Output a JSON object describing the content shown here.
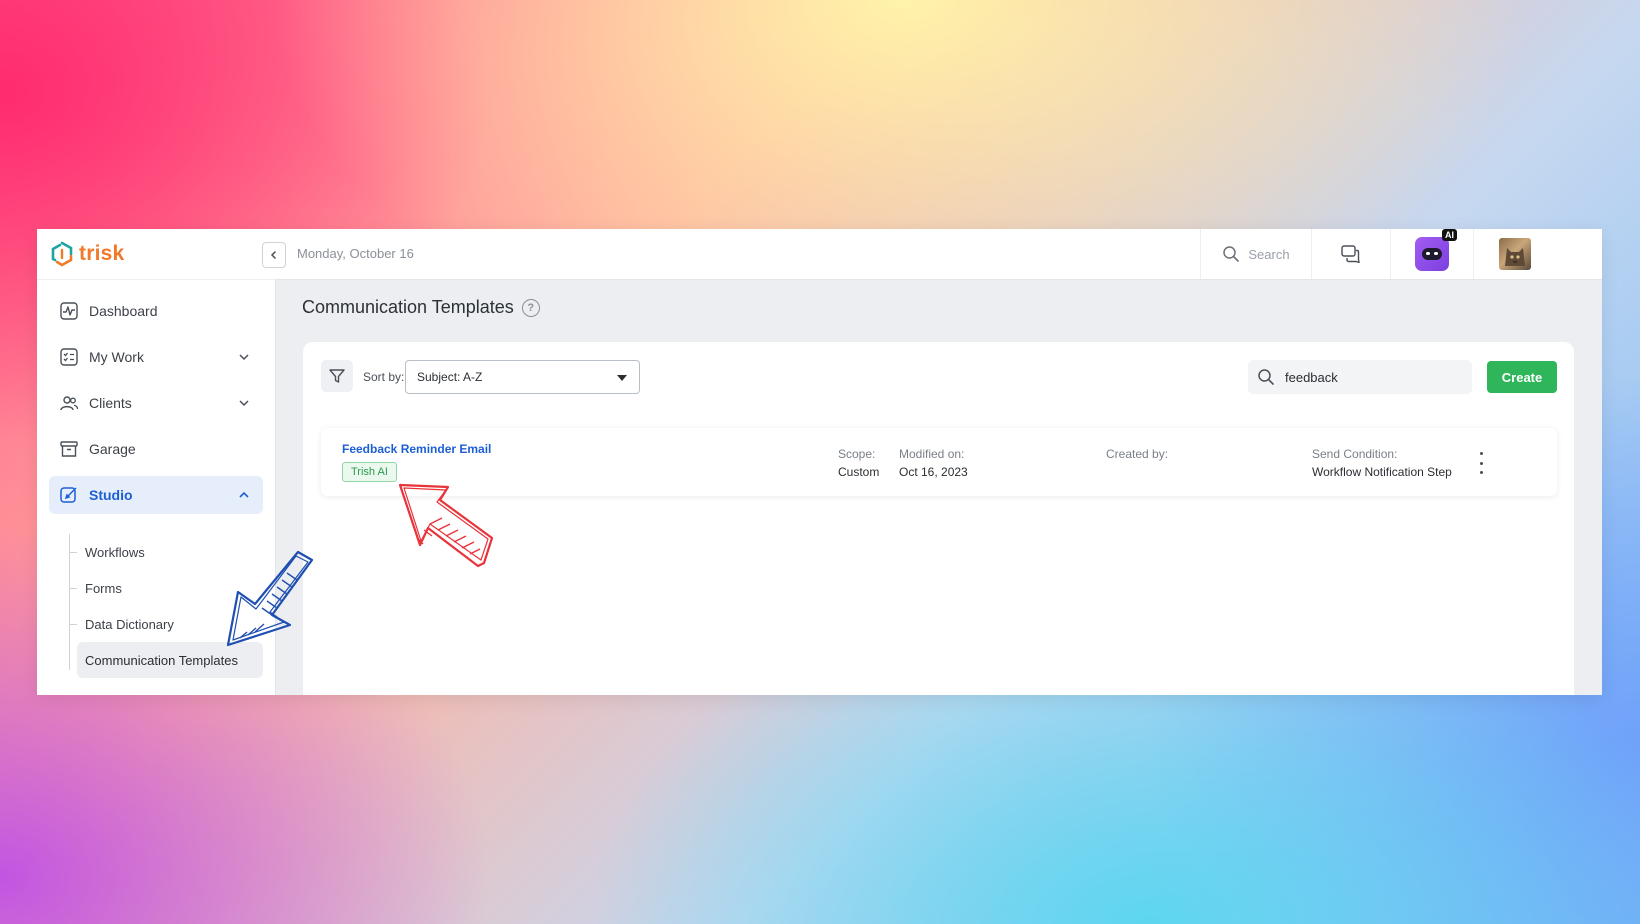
{
  "brand": {
    "name": "trisk",
    "colors": {
      "primary": "#1d5fd6",
      "brand_orange": "#f07a2a",
      "brand_teal": "#1fa3a3",
      "success": "#2fb65a"
    }
  },
  "topbar": {
    "date": "Monday, October 16",
    "search_label": "Search",
    "ai_badge": "AI"
  },
  "sidebar": {
    "items": [
      {
        "label": "Dashboard",
        "icon": "dashboard-icon"
      },
      {
        "label": "My Work",
        "icon": "my-work-icon"
      },
      {
        "label": "Clients",
        "icon": "clients-icon"
      },
      {
        "label": "Garage",
        "icon": "garage-icon"
      },
      {
        "label": "Studio",
        "icon": "studio-icon"
      }
    ],
    "subitems": [
      {
        "label": "Workflows"
      },
      {
        "label": "Forms"
      },
      {
        "label": "Data Dictionary"
      },
      {
        "label": "Communication Templates"
      }
    ]
  },
  "main": {
    "title": "Communication Templates",
    "help": "?",
    "sort_label": "Sort by:",
    "sort_value": "Subject: A-Z",
    "search_value": "feedback",
    "create_label": "Create",
    "rows": [
      {
        "title": "Feedback Reminder Email",
        "tag": "Trish AI",
        "scope_label": "Scope:",
        "scope": "Custom",
        "modified_label": "Modified on:",
        "modified": "Oct 16, 2023",
        "created_label": "Created by:",
        "created": "",
        "send_label": "Send Condition:",
        "send": "Workflow Notification Step"
      }
    ]
  }
}
